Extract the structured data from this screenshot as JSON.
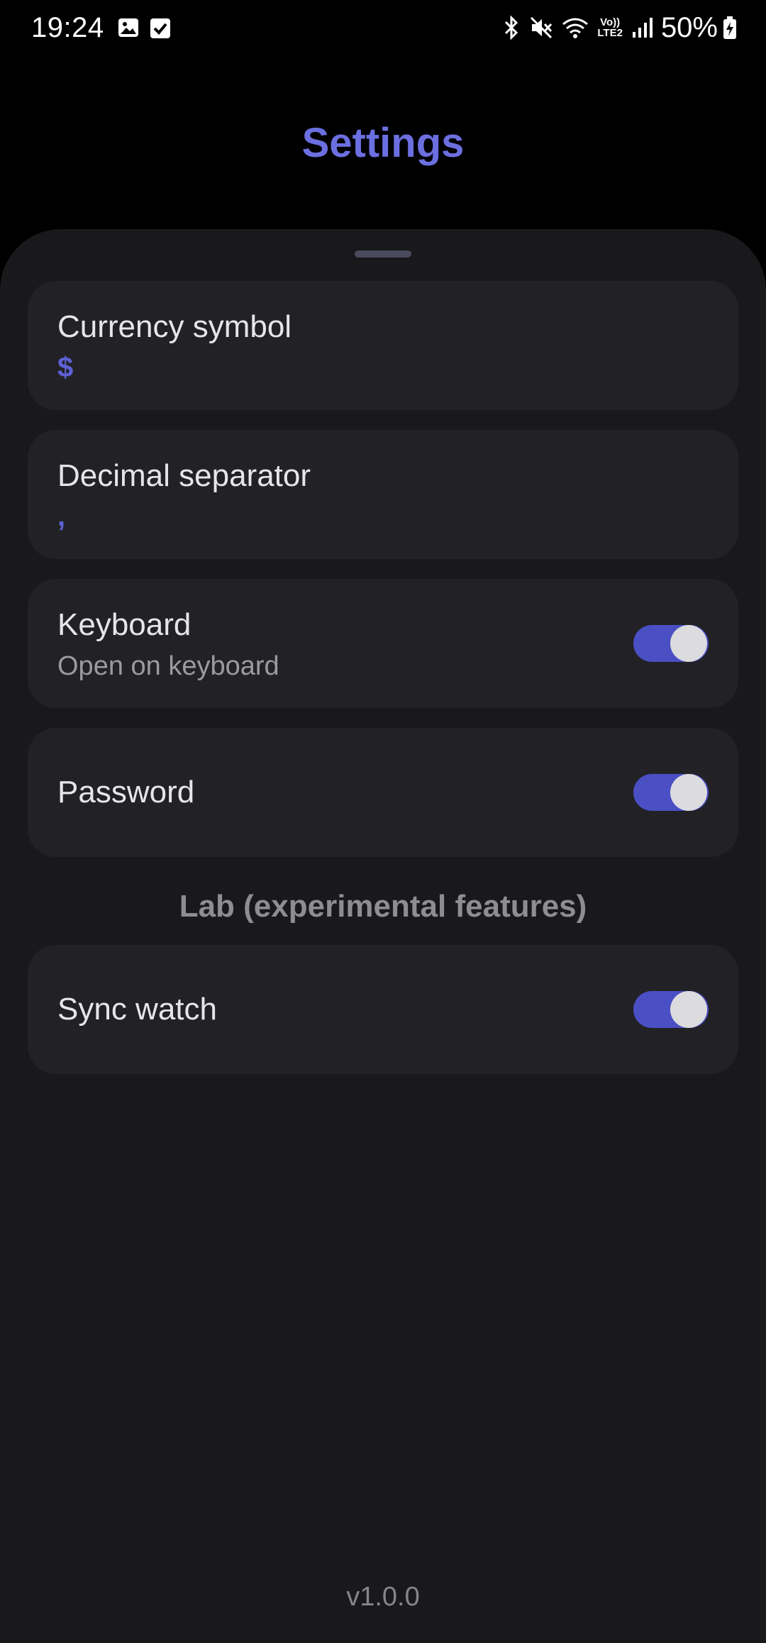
{
  "status_bar": {
    "time": "19:24",
    "battery": "50%",
    "network_label_top": "Vo))",
    "network_label_bottom": "LTE2",
    "icons": [
      "image-icon",
      "checkbox-icon",
      "bluetooth-icon",
      "mute-icon",
      "wifi-icon",
      "signal-icon",
      "battery-icon"
    ]
  },
  "header": {
    "title": "Settings"
  },
  "settings": {
    "currency": {
      "title": "Currency symbol",
      "value": "$"
    },
    "decimal": {
      "title": "Decimal separator",
      "value": ","
    },
    "keyboard": {
      "title": "Keyboard",
      "subtitle": "Open on keyboard",
      "enabled": true
    },
    "password": {
      "title": "Password",
      "enabled": true
    }
  },
  "lab": {
    "heading": "Lab (experimental features)",
    "sync_watch": {
      "title": "Sync watch",
      "enabled": true
    }
  },
  "footer": {
    "version": "v1.0.0"
  },
  "colors": {
    "accent": "#6b6fe0",
    "toggle_on": "#4b4fc4",
    "background": "#000000",
    "sheet": "#19191c",
    "card": "#222226"
  }
}
